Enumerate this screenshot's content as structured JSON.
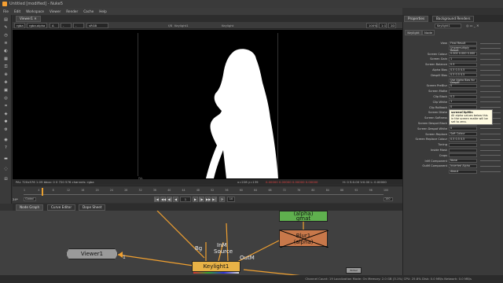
{
  "window": {
    "title": "Untitled [modified] - Nuke5"
  },
  "menu": [
    "File",
    "Edit",
    "Workspace",
    "Viewer",
    "Render",
    "Cache",
    "Help"
  ],
  "viewer": {
    "tab": "Viewer1",
    "channels": "rgba",
    "channels2": "rgba.alpha",
    "input_a": "A",
    "input_a_node": "-",
    "input_b": "-",
    "colorspace": "sRGB",
    "zoom": "100%",
    "ratio": "1:1",
    "mode": "2D",
    "input_a_label": "Keylight1",
    "input_b_label": "Keylight",
    "gain_label": "f/8",
    "gain": "1",
    "gamma": "1",
    "info_left": "PAL 720x576 1.09  bbox: 0 0 720 576 channels: rgba",
    "info_coords": "x=228 y=139",
    "info_values": "0.00000  0.00000  0.00000  0.00000",
    "info_hsv": "H: 0  S:0.00  V:0.00  L: 0.00000"
  },
  "timeline": {
    "ticks": [
      "1",
      "4",
      "8",
      "12",
      "16",
      "20",
      "24",
      "28",
      "32",
      "36",
      "40",
      "44",
      "48",
      "52",
      "56",
      "60",
      "64",
      "68",
      "72",
      "76",
      "80",
      "84",
      "88",
      "92",
      "96",
      "100"
    ],
    "frame": "1",
    "fps": "24*",
    "scope": "Global",
    "step": "10",
    "end": "100",
    "start": "1",
    "playhead_fraction": 0.05
  },
  "bottom_tabs": [
    "Node Graph",
    "Curve Editor",
    "Dope Sheet"
  ],
  "nodes": {
    "viewer": "Viewer1",
    "keylight": "Keylight1",
    "blur": "Blur1",
    "blur_sub": "(alpha)",
    "gmat_top": "(alpha)",
    "gmat": "gmat",
    "input_bg": "Bg",
    "input_inm": "InM",
    "input_source": "Source",
    "input_outm": "OutM",
    "pipe_num": "1",
    "small_node": "Write2"
  },
  "properties": {
    "tabs": [
      "Properties",
      "Background Renders"
    ],
    "node_name": "Keylight1",
    "subtabs": [
      "Keylight",
      "Node"
    ],
    "rows": [
      {
        "label": "View",
        "value": "Final Result"
      },
      {
        "label": "",
        "value": "Unpremultiply Result"
      },
      {
        "label": "Screen Colour",
        "value": "0.000  0.000  0.000"
      },
      {
        "label": "Screen Gain",
        "value": "1"
      },
      {
        "label": "Screen Balance",
        "value": "0.5"
      },
      {
        "label": "Alpha Bias",
        "value": "0.5  0.5  0.5"
      },
      {
        "label": "Despill Bias",
        "value": "0.5  0.5  0.5"
      },
      {
        "label": "",
        "value": "Use Alpha Bias for Despill"
      },
      {
        "label": "Screen PreBlur",
        "value": "0"
      },
      {
        "label": "Screen Matte",
        "value": ""
      },
      {
        "label": "Clip Black",
        "value": "0.2"
      },
      {
        "label": "Clip White",
        "value": "1"
      },
      {
        "label": "Clip Rollback",
        "value": "0"
      },
      {
        "label": "Screen Dilate",
        "value": "0"
      },
      {
        "label": "Screen Softness",
        "value": "0"
      },
      {
        "label": "Screen Despot Black",
        "value": "0"
      },
      {
        "label": "Screen Despot White",
        "value": "0"
      },
      {
        "label": "Screen Replace",
        "value": "Soft Colour"
      },
      {
        "label": "Screen Replace Colour",
        "value": "0.5  0.5  0.5"
      },
      {
        "label": "Tuning",
        "value": ""
      },
      {
        "label": "Inside Mask",
        "value": ""
      },
      {
        "label": "Crops",
        "value": ""
      },
      {
        "label": "InM Component",
        "value": "None"
      },
      {
        "label": "OutM Component",
        "value": "Inverted Alpha"
      },
      {
        "label": "",
        "value": "About"
      }
    ],
    "tooltip_title": "screenClipMin",
    "tooltip_body": "All alpha values below this in the screen matte will be set to zero."
  },
  "status": "Channel Count: 19  Localization Mode: On  Memory: 2.0 GB (3.1%)  CPU: 25.8%  Disk: 0.0 MB/s  Network: 0.0 MB/s",
  "colors": {
    "keylight": "#e8b246",
    "blur": "#c8784a",
    "viewer": "#9a9a9a",
    "gmat": "#5fb04e",
    "pipe": "#f0a030"
  }
}
